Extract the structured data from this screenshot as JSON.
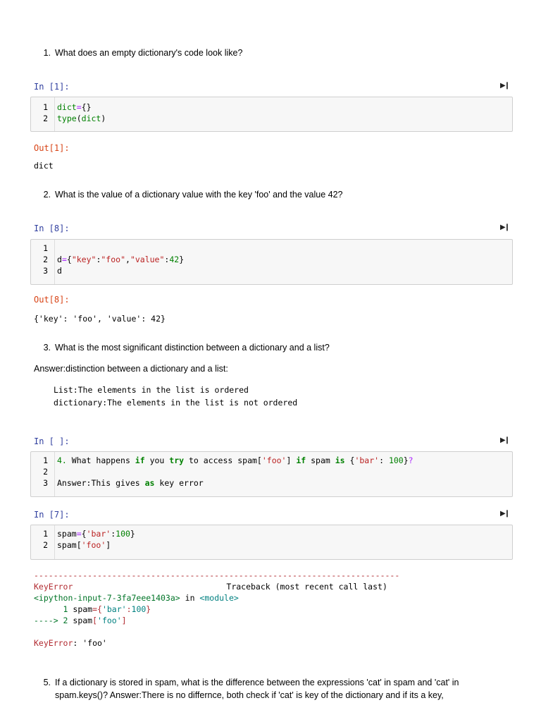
{
  "q1": {
    "num": "1.",
    "text": "What does an empty dictionary's code look like?"
  },
  "cell1": {
    "in_prompt": "In [1]:",
    "lines": [
      {
        "n": "1",
        "parts": [
          [
            "v",
            "dict"
          ],
          [
            "o",
            "="
          ],
          [
            "p",
            "{}"
          ]
        ]
      },
      {
        "n": "2",
        "parts": [
          [
            "k",
            "type"
          ],
          [
            "p",
            "("
          ],
          [
            "k",
            "dict"
          ],
          [
            "p",
            ")"
          ]
        ]
      }
    ],
    "out_prompt": "Out[1]:",
    "output": "dict"
  },
  "q2": {
    "num": "2.",
    "text": "What is the value of a dictionary value with the key 'foo' and the value 42?"
  },
  "cell2": {
    "in_prompt": "In [8]:",
    "lines": [
      {
        "n": "1",
        "parts": []
      },
      {
        "n": "2",
        "parts": [
          [
            "p",
            "d"
          ],
          [
            "o",
            "="
          ],
          [
            "p",
            "{"
          ],
          [
            "s",
            "\"key\""
          ],
          [
            "p",
            ":"
          ],
          [
            "s",
            "\"foo\""
          ],
          [
            "p",
            ","
          ],
          [
            "s",
            "\"value\""
          ],
          [
            "p",
            ":"
          ],
          [
            "n",
            "42"
          ],
          [
            "p",
            "}"
          ]
        ]
      },
      {
        "n": "3",
        "parts": [
          [
            "p",
            "d"
          ]
        ]
      }
    ],
    "out_prompt": "Out[8]:",
    "output": "{'key': 'foo', 'value': 42}"
  },
  "q3": {
    "num": "3.",
    "text": "What is the most significant distinction between a dictionary and a list?"
  },
  "answer3": {
    "intro": "Answer:distinction between a dictionary and a list:",
    "line1": "List:The elements in the list is ordered",
    "line2": "dictionary:The elements in the list is not ordered"
  },
  "cell3": {
    "in_prompt": "In [ ]:",
    "lines": [
      {
        "n": "1",
        "parts": [
          [
            "n",
            "4."
          ],
          [
            "p",
            " What happens "
          ],
          [
            "k",
            "if"
          ],
          [
            "p",
            " you "
          ],
          [
            "k",
            "try"
          ],
          [
            "p",
            " to access spam["
          ],
          [
            "s",
            "'foo'"
          ],
          [
            "p",
            "] "
          ],
          [
            "k",
            "if"
          ],
          [
            "p",
            " spam "
          ],
          [
            "k",
            "is"
          ],
          [
            "p",
            " {"
          ],
          [
            "s",
            "'bar'"
          ],
          [
            "p",
            ": "
          ],
          [
            "n",
            "100"
          ],
          [
            "p",
            "}"
          ],
          [
            "o",
            "?"
          ]
        ]
      },
      {
        "n": "2",
        "parts": []
      },
      {
        "n": "3",
        "parts": [
          [
            "p",
            "Answer:This gives "
          ],
          [
            "k",
            "as"
          ],
          [
            "p",
            " key error"
          ]
        ]
      }
    ]
  },
  "cell4": {
    "in_prompt": "In [7]:",
    "lines": [
      {
        "n": "1",
        "parts": [
          [
            "p",
            "spam"
          ],
          [
            "o",
            "="
          ],
          [
            "p",
            "{"
          ],
          [
            "s",
            "'bar'"
          ],
          [
            "p",
            ":"
          ],
          [
            "n",
            "100"
          ],
          [
            "p",
            "}"
          ]
        ]
      },
      {
        "n": "2",
        "parts": [
          [
            "p",
            "spam["
          ],
          [
            "s",
            "'foo'"
          ],
          [
            "p",
            "]"
          ]
        ]
      }
    ]
  },
  "traceback": {
    "rule": "---------------------------------------------------------------------------",
    "error_name": "KeyError",
    "traceback_label": "Traceback (most recent call last)",
    "input_ref": "<ipython-input-7-3fa7eee1403a>",
    "in_word": " in ",
    "module": "<module>",
    "line1_prefix": "      1 ",
    "line1_code_a": "spam",
    "line1_code_b": "={",
    "line1_code_c": "'bar'",
    "line1_code_d": ":",
    "line1_code_e": "100",
    "line1_code_f": "}",
    "line2_arrow": "----> 2 ",
    "line2_code_a": "spam",
    "line2_code_b": "[",
    "line2_code_c": "'foo'",
    "line2_code_d": "]",
    "final_name": "KeyError",
    "final_msg": ": 'foo'"
  },
  "q5": {
    "num": "5.",
    "line1": "If a dictionary is stored in spam, what is the difference between the expressions 'cat' in spam and 'cat' in",
    "line2": "spam.keys()? Answer:There is no differnce, both check if 'cat' is key of the dictionary and if its a key,"
  },
  "icons": {
    "run": "run-cell-icon"
  }
}
